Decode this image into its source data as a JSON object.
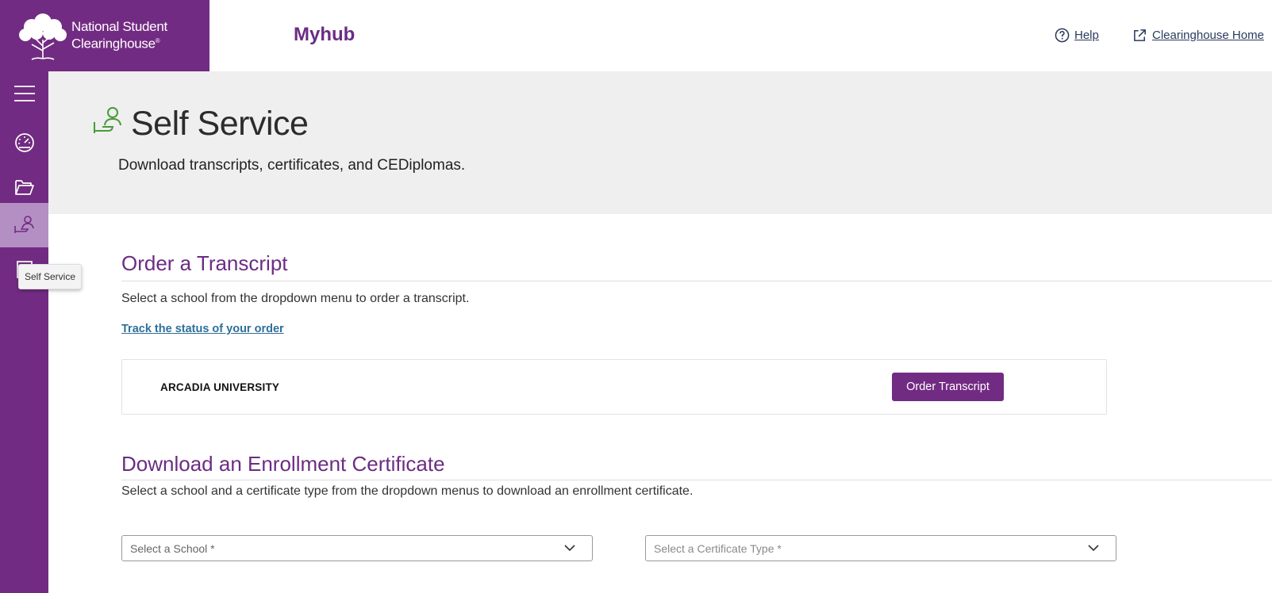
{
  "brand": {
    "logo_line1": "National Student",
    "logo_line2": "Clearinghouse",
    "logo_mark": "®",
    "app_name": "Myhub"
  },
  "header": {
    "help_label": "Help",
    "home_label": "Clearinghouse Home",
    "help_icon": "help-circle-icon",
    "home_icon": "external-link-icon"
  },
  "sidebar": {
    "items": [
      {
        "name": "menu",
        "icon": "hamburger-menu-icon"
      },
      {
        "name": "dashboard",
        "icon": "dashboard-gauge-icon"
      },
      {
        "name": "documents",
        "icon": "folder-icon"
      },
      {
        "name": "self-service",
        "icon": "self-service-icon",
        "active": true
      },
      {
        "name": "other",
        "icon": "document-icon"
      }
    ],
    "tooltip": "Self Service"
  },
  "hero": {
    "title": "Self Service",
    "subtitle": "Download transcripts, certificates, and CEDiplomas."
  },
  "transcript": {
    "title": "Order a Transcript",
    "description": "Select a school from the dropdown menu to order a transcript.",
    "track_link": "Track the status of your order",
    "school": "ARCADIA UNIVERSITY",
    "order_button": "Order Transcript"
  },
  "certificate": {
    "title": "Download an Enrollment Certificate",
    "description": "Select a school and a certificate type from the dropdown menus to download an enrollment certificate.",
    "school_placeholder": "Select a School *",
    "type_placeholder": "Select a Certificate Type *"
  },
  "colors": {
    "brand_purple": "#722b82",
    "accent_green": "#4a9a3a",
    "link_blue": "#2e6f9a"
  }
}
